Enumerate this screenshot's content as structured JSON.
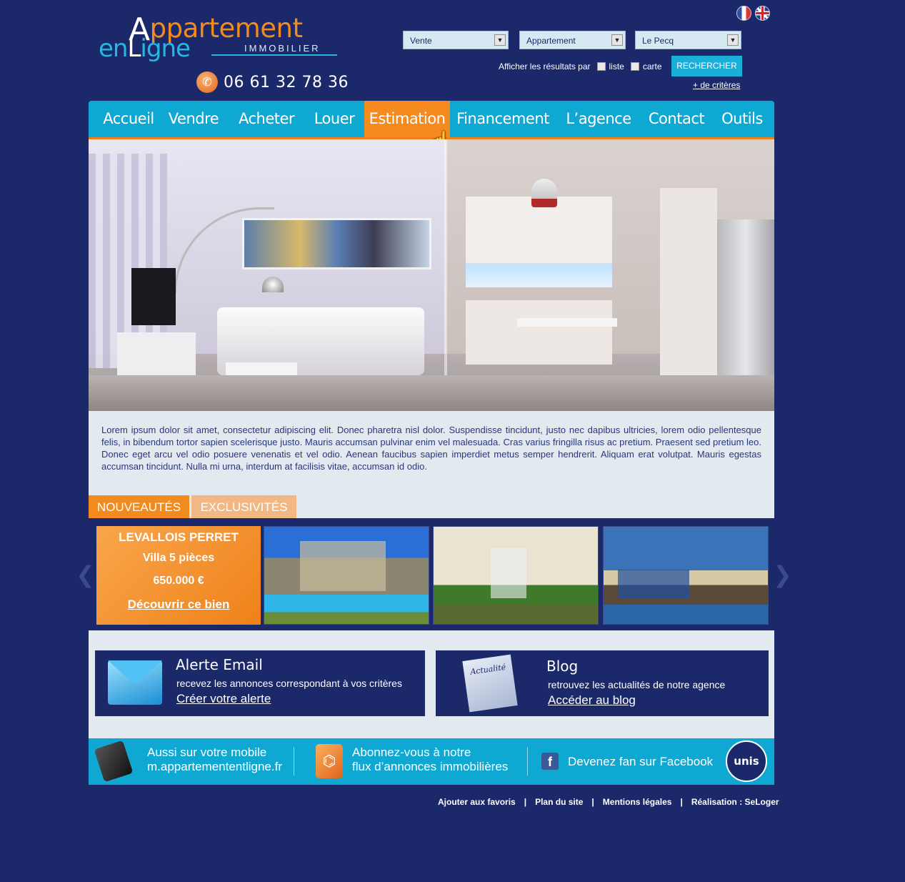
{
  "header": {
    "logo_top": "Appartement",
    "logo_bottom": "enLigne",
    "logo_sub": "IMMOBILIER",
    "phone": "06 61 32 78 36",
    "languages": [
      "Français",
      "English"
    ]
  },
  "search": {
    "transaction": "Vente",
    "property_type": "Appartement",
    "city": "Le Pecq",
    "display_label": "Afficher les résultats par",
    "option_list": "liste",
    "option_map": "carte",
    "submit": "RECHERCHER",
    "more_criteria": "+ de critères"
  },
  "nav": {
    "items": [
      "Accueil",
      "Vendre",
      "Acheter",
      "Louer",
      "Estimation",
      "Financement",
      "L’agence",
      "Contact",
      "Outils"
    ],
    "active": "Estimation"
  },
  "intro": {
    "text": "Lorem ipsum dolor sit amet, consectetur adipiscing elit. Donec pharetra nisl dolor. Suspendisse tincidunt, justo nec dapibus ultricies, lorem odio pellentesque felis, in bibendum tortor sapien scelerisque justo. Mauris accumsan pulvinar enim vel malesuada. Cras varius fringilla risus ac pretium. Praesent sed pretium leo. Donec eget arcu vel odio posuere venenatis et vel odio. Aenean faucibus sapien imperdiet metus semper hendrerit. Aliquam erat volutpat. Mauris egestas accumsan tincidunt. Nulla mi urna, interdum at facilisis vitae, accumsan id odio."
  },
  "tabs": {
    "new": "NOUVEAUTÉS",
    "exclusive": "EXCLUSIVITÉS"
  },
  "featured": {
    "city": "LEVALLOIS PERRET",
    "type": "Villa 5 pièces",
    "price": "650.000 €",
    "link": "Découvrir ce bien"
  },
  "alert": {
    "title": "Alerte Email",
    "desc": "recevez les annonces correspondant à vos critères",
    "cta": "Créer votre alerte"
  },
  "blog": {
    "title": "Blog",
    "icon_label": "Actualité",
    "desc": "retrouvez les actualités de notre agence",
    "cta": "Accéder au blog"
  },
  "footer_bar": {
    "mobile_line1": "Aussi sur votre mobile",
    "mobile_line2": "m.appartemententligne.fr",
    "rss_line1": "Abonnez-vous à notre",
    "rss_line2": "flux d’annonces immobilières",
    "facebook": "Devenez fan sur Facebook",
    "unis": "unis"
  },
  "footer_links": [
    "Ajouter aux favoris",
    "Plan du site",
    "Mentions légales",
    "Réalisation : SeLoger"
  ]
}
